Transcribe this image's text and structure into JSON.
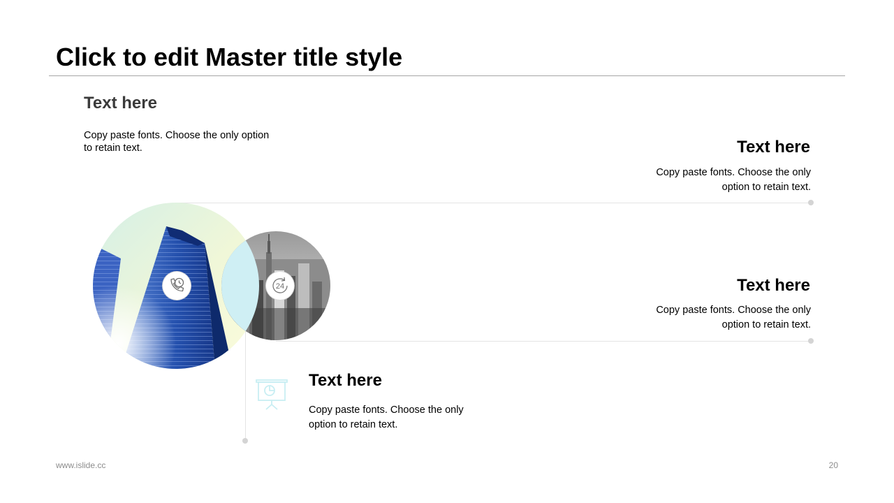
{
  "slide": {
    "title": "Click to edit Master title style",
    "page_number": "20",
    "footer_url": "www.islide.cc"
  },
  "blocks": [
    {
      "heading": "Text here",
      "body": "Copy paste fonts. Choose the only option to retain text."
    },
    {
      "heading": "Text here",
      "body": "Copy paste fonts. Choose the only option to retain text."
    },
    {
      "heading": "Text here",
      "body": "Copy paste fonts. Choose the only option to retain text."
    },
    {
      "heading": "Text here",
      "body": "Copy paste fonts. Choose the only option to retain text."
    }
  ],
  "icons": {
    "phone_clock": "phone-clock-icon",
    "service_24": "24-hour-service-icon",
    "presentation": "presentation-board-icon"
  },
  "colors": {
    "accent": "#cfeff4",
    "divider": "#e4e4e4",
    "dot": "#d4d4d4",
    "footer_text": "#8c8c8c"
  }
}
